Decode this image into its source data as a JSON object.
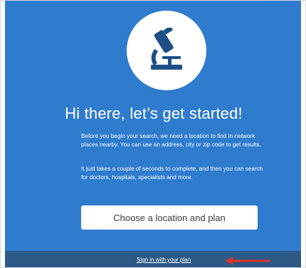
{
  "onboarding": {
    "headline": "Hi there, let’s get started!",
    "paragraph_1": "Before you begin your search, we need a location to find in-network places nearby. You can use an address, city or zip code to get results.",
    "paragraph_2": "It just takes a couple of seconds to complete, and then you can search for doctors, hospitals, specialists and more.",
    "primary_button_label": "Choose a location and plan",
    "sign_in_link": "Sign in with your plan"
  },
  "icons": {
    "hero": "microscope-icon",
    "annotation": "red-arrow-icon"
  },
  "colors": {
    "panel_background": "#2f7bcd",
    "footer_background": "#2c5986",
    "icon_color": "#1d4f86",
    "annotation_red": "#d9342b"
  }
}
